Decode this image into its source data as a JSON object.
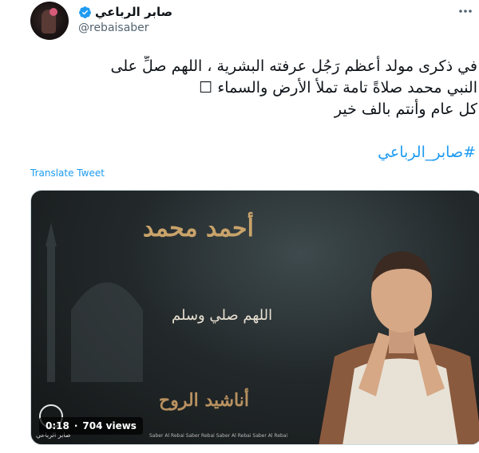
{
  "author": {
    "display_name": "صابر الرباعي",
    "handle": "@rebaisaber"
  },
  "tweet": {
    "lines": [
      "في ذكرى مولد أعظم رَجُل عرفته البشرية ، اللهم صلِّ على",
      "النبي محمد صلاةً تامة تملأ الأرض والسماء ☐",
      "كل عام وأنتم بالف خير"
    ],
    "hashtag": "#صابر_الرباعي",
    "translate_label": "Translate Tweet"
  },
  "media": {
    "title_gold": "أحمد محمد",
    "subtitle": "اللهم صلي وسلم",
    "album_title": "أناشيد الروح",
    "logo_text": "صابر الرباعي",
    "socials_text": "Saber Al Rebai   Saber Rebai   Saber Al Rebai   Saber Al Rebai",
    "elapsed": "0:18",
    "views": "704 views"
  },
  "icons": [
    "verified-badge-icon",
    "more-options-icon"
  ],
  "colors": {
    "link": "#1d9bf0",
    "text": "#0f1419",
    "muted": "#536471",
    "gold": "#c9a36a"
  }
}
